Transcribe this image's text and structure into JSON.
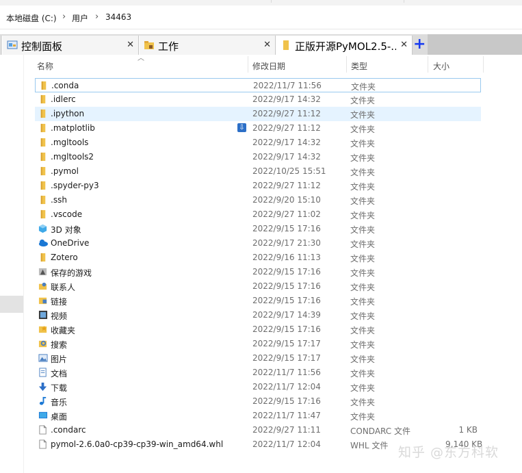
{
  "breadcrumb": {
    "items": [
      "本地磁盘 (C:)",
      "用户",
      "34463"
    ]
  },
  "tabs": [
    {
      "label": "控制面板"
    },
    {
      "label": "工作"
    },
    {
      "label": "正版开源PyMOL2.5-..."
    }
  ],
  "tab_close_glyph": "✕",
  "tab_add_glyph": "+",
  "columns": {
    "name": "名称",
    "modified": "修改日期",
    "type": "类型",
    "size": "大小"
  },
  "rows": [
    {
      "name": ".conda",
      "date": "2022/11/7 11:56",
      "type": "文件夹",
      "size": "",
      "icon": "folder-icon"
    },
    {
      "name": ".idlerc",
      "date": "2022/9/17 14:32",
      "type": "文件夹",
      "size": "",
      "icon": "folder-icon"
    },
    {
      "name": ".ipython",
      "date": "2022/9/27 11:12",
      "type": "文件夹",
      "size": "",
      "icon": "folder-icon"
    },
    {
      "name": ".matplotlib",
      "date": "2022/9/27 11:12",
      "type": "文件夹",
      "size": "",
      "icon": "folder-icon"
    },
    {
      "name": ".mgltools",
      "date": "2022/9/17 14:32",
      "type": "文件夹",
      "size": "",
      "icon": "folder-icon"
    },
    {
      "name": ".mgltools2",
      "date": "2022/9/17 14:32",
      "type": "文件夹",
      "size": "",
      "icon": "folder-icon"
    },
    {
      "name": ".pymol",
      "date": "2022/10/25 15:51",
      "type": "文件夹",
      "size": "",
      "icon": "folder-icon"
    },
    {
      "name": ".spyder-py3",
      "date": "2022/9/27 11:12",
      "type": "文件夹",
      "size": "",
      "icon": "folder-icon"
    },
    {
      "name": ".ssh",
      "date": "2022/9/20 15:10",
      "type": "文件夹",
      "size": "",
      "icon": "folder-icon"
    },
    {
      "name": ".vscode",
      "date": "2022/9/27 11:02",
      "type": "文件夹",
      "size": "",
      "icon": "folder-icon"
    },
    {
      "name": "3D 对象",
      "date": "2022/9/15 17:16",
      "type": "文件夹",
      "size": "",
      "icon": "3d-objects-icon"
    },
    {
      "name": "OneDrive",
      "date": "2022/9/17 21:30",
      "type": "文件夹",
      "size": "",
      "icon": "onedrive-icon"
    },
    {
      "name": "Zotero",
      "date": "2022/9/16 11:13",
      "type": "文件夹",
      "size": "",
      "icon": "folder-icon"
    },
    {
      "name": "保存的游戏",
      "date": "2022/9/15 17:16",
      "type": "文件夹",
      "size": "",
      "icon": "saved-games-icon"
    },
    {
      "name": "联系人",
      "date": "2022/9/15 17:16",
      "type": "文件夹",
      "size": "",
      "icon": "contacts-icon"
    },
    {
      "name": "链接",
      "date": "2022/9/15 17:16",
      "type": "文件夹",
      "size": "",
      "icon": "links-icon"
    },
    {
      "name": "视频",
      "date": "2022/9/17 14:39",
      "type": "文件夹",
      "size": "",
      "icon": "videos-icon"
    },
    {
      "name": "收藏夹",
      "date": "2022/9/15 17:16",
      "type": "文件夹",
      "size": "",
      "icon": "favorites-icon"
    },
    {
      "name": "搜索",
      "date": "2022/9/15 17:17",
      "type": "文件夹",
      "size": "",
      "icon": "searches-icon"
    },
    {
      "name": "图片",
      "date": "2022/9/15 17:17",
      "type": "文件夹",
      "size": "",
      "icon": "pictures-icon"
    },
    {
      "name": "文档",
      "date": "2022/11/7 11:56",
      "type": "文件夹",
      "size": "",
      "icon": "documents-icon"
    },
    {
      "name": "下载",
      "date": "2022/11/7 12:04",
      "type": "文件夹",
      "size": "",
      "icon": "downloads-icon"
    },
    {
      "name": "音乐",
      "date": "2022/9/15 17:16",
      "type": "文件夹",
      "size": "",
      "icon": "music-icon"
    },
    {
      "name": "桌面",
      "date": "2022/11/7 11:47",
      "type": "文件夹",
      "size": "",
      "icon": "desktop-icon"
    },
    {
      "name": ".condarc",
      "date": "2022/9/27 11:11",
      "type": "CONDARC 文件",
      "size": "1 KB",
      "icon": "file-icon"
    },
    {
      "name": "pymol-2.6.0a0-cp39-cp39-win_amd64.whl",
      "date": "2022/11/7 12:04",
      "type": "WHL 文件",
      "size": "9,140 KB",
      "icon": "file-icon"
    }
  ],
  "watermark": "知乎 @东方科软",
  "colors": {
    "accent": "#1a3cf0",
    "folder": "#f0c24b",
    "hover": "#e5f3ff",
    "focus": "#99c9ef"
  }
}
